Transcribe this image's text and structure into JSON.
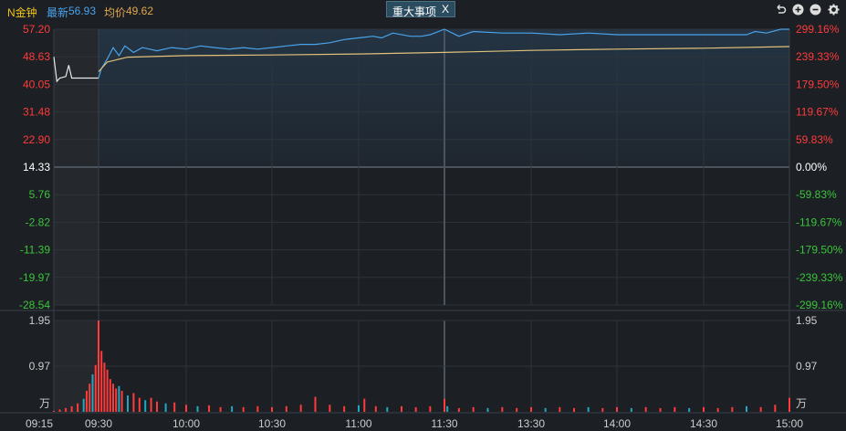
{
  "header": {
    "stock_name": "N金钟",
    "latest_label": "最新",
    "latest_value": "56.93",
    "avg_label": "均价",
    "avg_value": "49.62",
    "tab_label": "重大事项",
    "tab_close": "X",
    "tool_icons": [
      "undo-icon",
      "zoom-in-icon",
      "zoom-out-icon",
      "settings-icon"
    ]
  },
  "colors": {
    "background": "#1c1f24",
    "price_line": "#4aa3ea",
    "avg_line": "#e2c27a",
    "up": "#ff3b3b",
    "down": "#3bc43b",
    "neutral": "#ffffff",
    "up_volume": "#ff3b3b",
    "down_volume": "#1fa8c0",
    "grid": "#2e343b",
    "grid_mid": "#4b535c"
  },
  "chart_data": [
    {
      "type": "line",
      "name": "price-chart",
      "y_left_ticks": [
        "57.20",
        "48.63",
        "40.05",
        "31.48",
        "22.90",
        "14.33",
        "5.76",
        "-2.82",
        "-11.39",
        "-19.97",
        "-28.54"
      ],
      "y_right_ticks": [
        "299.16%",
        "239.33%",
        "179.50%",
        "119.67%",
        "59.83%",
        "0.00%",
        "-59.83%",
        "-119.67%",
        "-179.50%",
        "-239.33%",
        "-299.16%"
      ],
      "ylim": [
        -28.54,
        57.2
      ],
      "prev_close": 14.33,
      "x_ticks": [
        "09:15",
        "09:30",
        "10:00",
        "10:30",
        "11:00",
        "11:30",
        "13:30",
        "14:00",
        "14:30",
        "15:00"
      ],
      "series": [
        {
          "role": "price",
          "points": [
            [
              "09:15",
              48.6
            ],
            [
              "09:16",
              41.0
            ],
            [
              "09:17",
              42.0
            ],
            [
              "09:19",
              42.5
            ],
            [
              "09:20",
              46.0
            ],
            [
              "09:21",
              42.0
            ],
            [
              "09:25",
              42.0
            ],
            [
              "09:30",
              42.0
            ],
            [
              "09:31",
              45.0
            ],
            [
              "09:33",
              48.0
            ],
            [
              "09:35",
              51.5
            ],
            [
              "09:37",
              49.0
            ],
            [
              "09:39",
              52.0
            ],
            [
              "09:42",
              50.0
            ],
            [
              "09:45",
              51.5
            ],
            [
              "09:50",
              50.5
            ],
            [
              "09:55",
              51.5
            ],
            [
              "10:00",
              51.0
            ],
            [
              "10:05",
              52.0
            ],
            [
              "10:10",
              51.5
            ],
            [
              "10:15",
              51.0
            ],
            [
              "10:20",
              51.5
            ],
            [
              "10:25",
              51.0
            ],
            [
              "10:30",
              51.5
            ],
            [
              "10:35",
              52.0
            ],
            [
              "10:40",
              52.5
            ],
            [
              "10:45",
              52.5
            ],
            [
              "10:50",
              53.0
            ],
            [
              "10:55",
              54.0
            ],
            [
              "11:00",
              54.5
            ],
            [
              "11:05",
              55.0
            ],
            [
              "11:08",
              54.5
            ],
            [
              "11:12",
              56.0
            ],
            [
              "11:18",
              55.0
            ],
            [
              "11:22",
              55.0
            ],
            [
              "11:25",
              55.5
            ],
            [
              "11:30",
              57.2
            ],
            [
              "13:00",
              57.2
            ],
            [
              "13:05",
              55.0
            ],
            [
              "13:10",
              56.5
            ],
            [
              "13:20",
              56.0
            ],
            [
              "13:30",
              56.0
            ],
            [
              "13:40",
              55.5
            ],
            [
              "13:50",
              56.0
            ],
            [
              "14:00",
              55.5
            ],
            [
              "14:10",
              55.5
            ],
            [
              "14:20",
              55.5
            ],
            [
              "14:30",
              55.5
            ],
            [
              "14:40",
              55.5
            ],
            [
              "14:45",
              55.5
            ],
            [
              "14:48",
              56.5
            ],
            [
              "14:52",
              56.0
            ],
            [
              "14:57",
              57.2
            ],
            [
              "15:00",
              57.2
            ]
          ]
        },
        {
          "role": "average",
          "points": [
            [
              "09:30",
              44.0
            ],
            [
              "09:33",
              47.0
            ],
            [
              "09:40",
              48.5
            ],
            [
              "10:00",
              49.0
            ],
            [
              "10:30",
              49.2
            ],
            [
              "11:00",
              49.5
            ],
            [
              "11:30",
              50.0
            ],
            [
              "13:30",
              50.6
            ],
            [
              "14:00",
              51.0
            ],
            [
              "14:30",
              51.3
            ],
            [
              "15:00",
              51.8
            ]
          ]
        }
      ]
    },
    {
      "type": "bar",
      "name": "volume-chart",
      "y_ticks": [
        "1.95",
        "0.97"
      ],
      "unit": "万",
      "ylim": [
        0,
        1.95
      ],
      "x_range": [
        "09:15",
        "15:00"
      ],
      "bars": [
        [
          "09:15",
          0.02,
          "up"
        ],
        [
          "09:17",
          0.05,
          "up"
        ],
        [
          "09:19",
          0.08,
          "up"
        ],
        [
          "09:21",
          0.12,
          "up"
        ],
        [
          "09:23",
          0.18,
          "up"
        ],
        [
          "09:25",
          0.28,
          "down"
        ],
        [
          "09:26",
          0.45,
          "up"
        ],
        [
          "09:27",
          0.6,
          "up"
        ],
        [
          "09:28",
          0.8,
          "down"
        ],
        [
          "09:29",
          1.0,
          "up"
        ],
        [
          "09:30",
          1.95,
          "up"
        ],
        [
          "09:31",
          1.3,
          "up"
        ],
        [
          "09:32",
          1.05,
          "up"
        ],
        [
          "09:33",
          0.9,
          "up"
        ],
        [
          "09:34",
          0.7,
          "up"
        ],
        [
          "09:35",
          0.6,
          "up"
        ],
        [
          "09:36",
          0.5,
          "up"
        ],
        [
          "09:37",
          0.55,
          "down"
        ],
        [
          "09:38",
          0.45,
          "up"
        ],
        [
          "09:40",
          0.35,
          "down"
        ],
        [
          "09:42",
          0.4,
          "up"
        ],
        [
          "09:44",
          0.3,
          "up"
        ],
        [
          "09:46",
          0.25,
          "down"
        ],
        [
          "09:48",
          0.3,
          "up"
        ],
        [
          "09:50",
          0.22,
          "up"
        ],
        [
          "09:53",
          0.18,
          "down"
        ],
        [
          "09:56",
          0.2,
          "up"
        ],
        [
          "10:00",
          0.15,
          "up"
        ],
        [
          "10:04",
          0.12,
          "down"
        ],
        [
          "10:08",
          0.14,
          "up"
        ],
        [
          "10:12",
          0.1,
          "up"
        ],
        [
          "10:16",
          0.12,
          "down"
        ],
        [
          "10:20",
          0.1,
          "up"
        ],
        [
          "10:25",
          0.12,
          "up"
        ],
        [
          "10:30",
          0.1,
          "up"
        ],
        [
          "10:35",
          0.12,
          "up"
        ],
        [
          "10:40",
          0.15,
          "up"
        ],
        [
          "10:45",
          0.32,
          "up"
        ],
        [
          "10:50",
          0.15,
          "up"
        ],
        [
          "10:55",
          0.12,
          "up"
        ],
        [
          "11:00",
          0.14,
          "down"
        ],
        [
          "11:02",
          0.28,
          "up"
        ],
        [
          "11:06",
          0.12,
          "up"
        ],
        [
          "11:10",
          0.1,
          "down"
        ],
        [
          "11:15",
          0.12,
          "up"
        ],
        [
          "11:20",
          0.1,
          "up"
        ],
        [
          "11:25",
          0.12,
          "up"
        ],
        [
          "11:30",
          0.28,
          "up"
        ],
        [
          "13:01",
          0.12,
          "down"
        ],
        [
          "13:05",
          0.08,
          "up"
        ],
        [
          "13:10",
          0.1,
          "up"
        ],
        [
          "13:15",
          0.08,
          "down"
        ],
        [
          "13:20",
          0.1,
          "up"
        ],
        [
          "13:25",
          0.08,
          "up"
        ],
        [
          "13:30",
          0.1,
          "up"
        ],
        [
          "13:35",
          0.08,
          "down"
        ],
        [
          "13:40",
          0.1,
          "up"
        ],
        [
          "13:45",
          0.08,
          "up"
        ],
        [
          "13:50",
          0.1,
          "down"
        ],
        [
          "13:55",
          0.08,
          "up"
        ],
        [
          "14:00",
          0.1,
          "up"
        ],
        [
          "14:05",
          0.08,
          "down"
        ],
        [
          "14:10",
          0.1,
          "up"
        ],
        [
          "14:15",
          0.08,
          "up"
        ],
        [
          "14:20",
          0.1,
          "up"
        ],
        [
          "14:25",
          0.08,
          "down"
        ],
        [
          "14:30",
          0.1,
          "up"
        ],
        [
          "14:35",
          0.08,
          "up"
        ],
        [
          "14:40",
          0.1,
          "up"
        ],
        [
          "14:45",
          0.12,
          "down"
        ],
        [
          "14:50",
          0.1,
          "up"
        ],
        [
          "14:55",
          0.15,
          "up"
        ],
        [
          "15:00",
          0.3,
          "up"
        ]
      ]
    }
  ]
}
